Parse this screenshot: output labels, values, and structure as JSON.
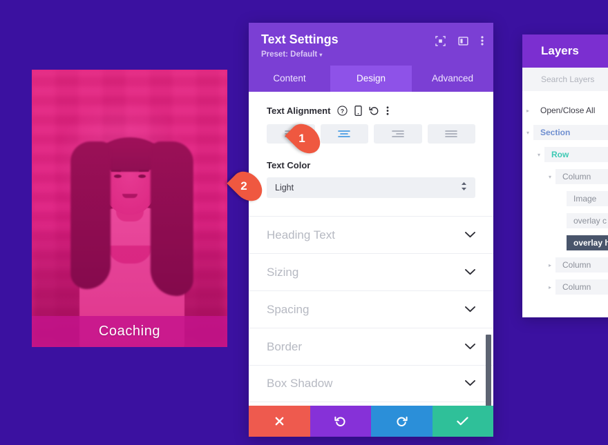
{
  "background_color": "#3b11a0",
  "coaching_card": {
    "caption": "Coaching",
    "overlay_color": "#e91e91",
    "caption_bar_color": "#c4148c",
    "image_alt": "portrait of woman with long dark hair"
  },
  "settings_panel": {
    "title": "Text Settings",
    "preset": "Preset: Default",
    "preset_caret": "▾",
    "header_color": "#7b3fd4",
    "header_icons": [
      {
        "name": "focus-target-icon"
      },
      {
        "name": "layout-panel-icon"
      },
      {
        "name": "kebab-menu-icon"
      }
    ],
    "tabs": [
      {
        "label": "Content",
        "active": false
      },
      {
        "label": "Design",
        "active": true
      },
      {
        "label": "Advanced",
        "active": false
      }
    ],
    "text_alignment": {
      "label": "Text Alignment",
      "icons": [
        {
          "name": "help-icon",
          "glyph": "?"
        },
        {
          "name": "responsive-device-icon"
        },
        {
          "name": "reset-icon"
        },
        {
          "name": "kebab-menu-icon"
        }
      ],
      "options": [
        {
          "name": "align-left",
          "active": false
        },
        {
          "name": "align-center",
          "active": true
        },
        {
          "name": "align-right",
          "active": false
        },
        {
          "name": "align-justify",
          "active": false
        }
      ],
      "active_color": "#2d8ee0"
    },
    "text_color": {
      "label": "Text Color",
      "value": "Light"
    },
    "accordions": [
      {
        "label": "Heading Text"
      },
      {
        "label": "Sizing"
      },
      {
        "label": "Spacing"
      },
      {
        "label": "Border"
      },
      {
        "label": "Box Shadow"
      }
    ],
    "footer_buttons": [
      {
        "name": "cancel-button",
        "color": "#ee5a4e",
        "icon": "close-icon"
      },
      {
        "name": "undo-button",
        "color": "#8631d8",
        "icon": "undo-icon"
      },
      {
        "name": "redo-button",
        "color": "#2b8fd9",
        "icon": "redo-icon"
      },
      {
        "name": "save-button",
        "color": "#2fc099",
        "icon": "check-icon"
      }
    ]
  },
  "layers_panel": {
    "title": "Layers",
    "header_color": "#7b2fd0",
    "search_placeholder": "Search Layers",
    "items": [
      {
        "label": "Open/Close All",
        "depth": 0,
        "arrow": "▸",
        "type": "open-close"
      },
      {
        "label": "Section",
        "depth": 0,
        "arrow": "▾",
        "type": "section"
      },
      {
        "label": "Row",
        "depth": 1,
        "arrow": "▾",
        "type": "row-lvl"
      },
      {
        "label": "Column",
        "depth": 2,
        "arrow": "▾",
        "type": "column"
      },
      {
        "label": "Image",
        "depth": 3,
        "arrow": "",
        "type": "module"
      },
      {
        "label": "overlay c",
        "depth": 3,
        "arrow": "",
        "type": "module"
      },
      {
        "label": "overlay h",
        "depth": 3,
        "arrow": "",
        "type": "selected"
      },
      {
        "label": "Column",
        "depth": 2,
        "arrow": "▸",
        "type": "column"
      },
      {
        "label": "Column",
        "depth": 2,
        "arrow": "▸",
        "type": "column"
      }
    ]
  },
  "markers": [
    {
      "number": "1",
      "color": "#ef5840"
    },
    {
      "number": "2",
      "color": "#ef5840"
    }
  ]
}
